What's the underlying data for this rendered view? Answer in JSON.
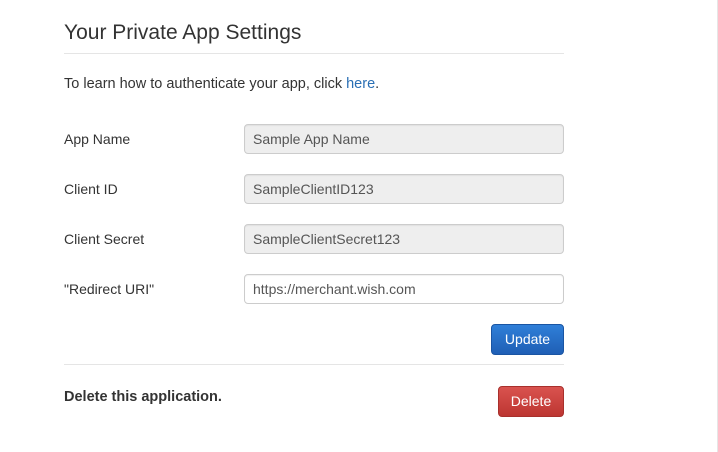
{
  "header": {
    "title": "Your Private App Settings"
  },
  "intro": {
    "text": "To learn how to authenticate your app, click ",
    "link_label": "here",
    "suffix": "."
  },
  "form": {
    "app_name": {
      "label": "App Name",
      "value": "Sample App Name"
    },
    "client_id": {
      "label": "Client ID",
      "value": "SampleClientID123"
    },
    "client_secret": {
      "label": "Client Secret",
      "value": "SampleClientSecret123"
    },
    "redirect_uri": {
      "label": "\"Redirect URI\"",
      "value": "https://merchant.wish.com"
    },
    "update_label": "Update"
  },
  "danger": {
    "label": "Delete this application.",
    "delete_label": "Delete"
  },
  "colors": {
    "link": "#2a6fb4",
    "primary_button": "#1f5fb5",
    "danger_button": "#c9302c",
    "readonly_field": "#eeeeee"
  }
}
